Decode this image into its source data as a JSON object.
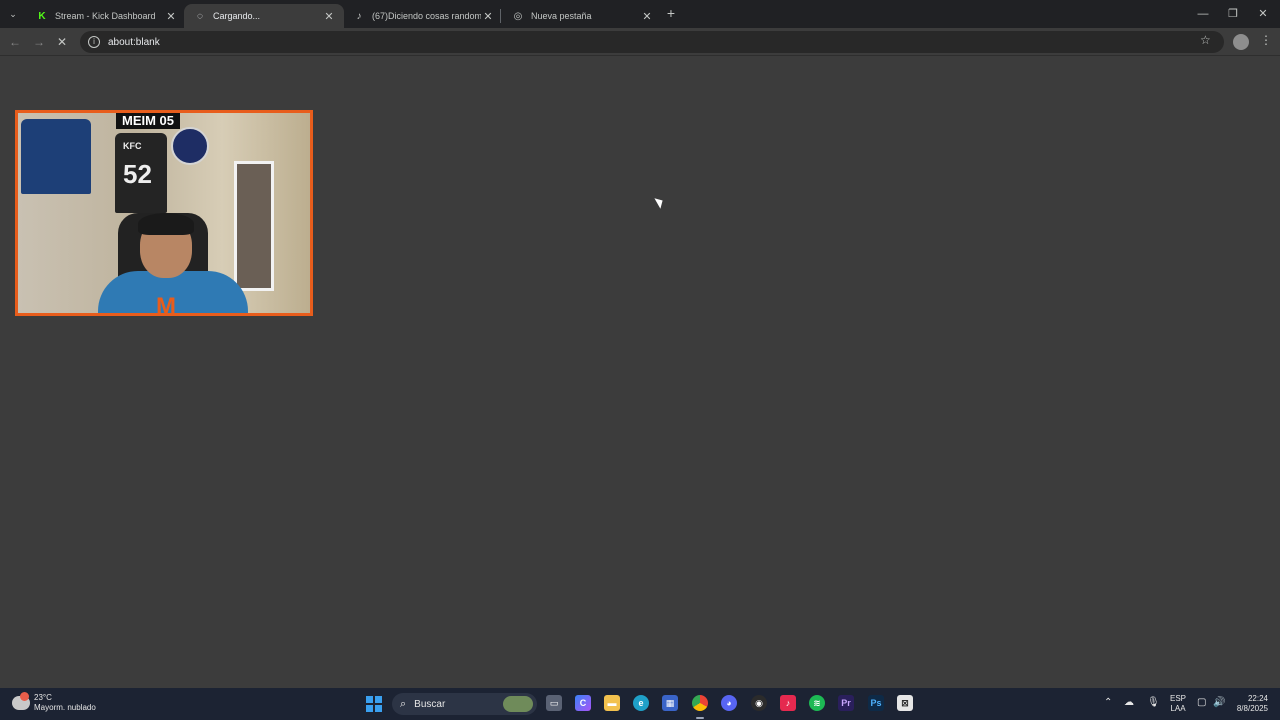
{
  "browser": {
    "tabs": [
      {
        "title": "Stream - Kick Dashboard",
        "favicon": "kick-icon",
        "color": "#53fc18"
      },
      {
        "title": "Cargando...",
        "favicon": "loading-spinner-icon",
        "active": true
      },
      {
        "title": "(67)Diciendo cosas random y e",
        "favicon": "tiktok-icon"
      },
      {
        "title": "Nueva pestaña",
        "favicon": "chrome-icon"
      }
    ],
    "address": "about:blank"
  },
  "stream": {
    "overlay_title": "MEIM 05",
    "jersey_brand": "KFC",
    "jersey_number": "52",
    "accent_color": "#e85d1c"
  },
  "taskbar": {
    "weather_temp": "23°C",
    "weather_desc": "Mayorm. nublado",
    "search_label": "Buscar",
    "lang_1": "ESP",
    "lang_2": "LAA",
    "time": "22:24",
    "date": "8/8/2025"
  }
}
